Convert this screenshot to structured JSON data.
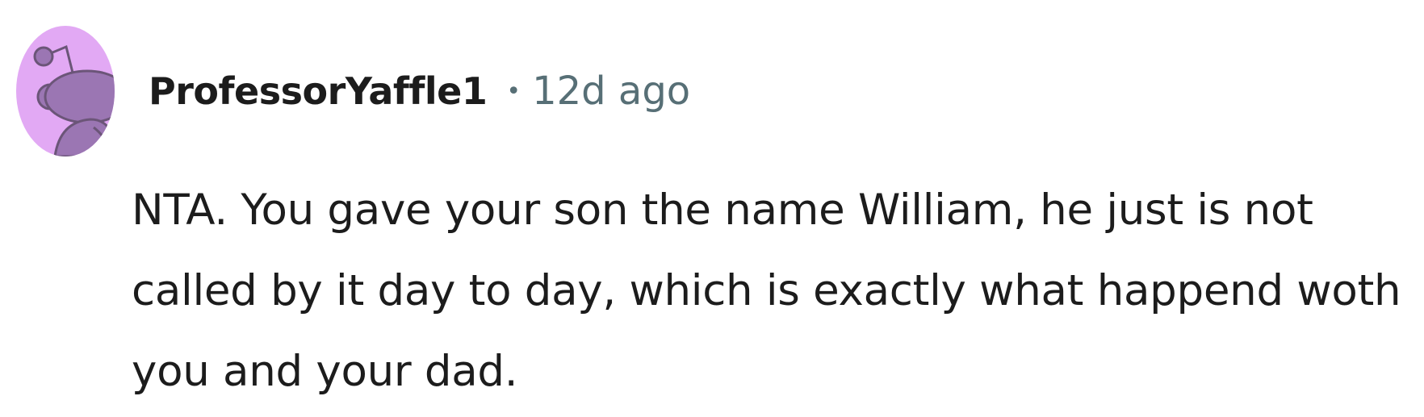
{
  "comment": {
    "author": "ProfessorYaffle1",
    "separator": "•",
    "timestamp": "12d ago",
    "text": "NTA. You gave your son the name William, he just is not called by it day to day, which is exactly what happend woth you and your dad."
  },
  "avatar": {
    "icon": "reddit-snoo-avatar-icon",
    "background_color": "#e2a9f4",
    "figure_color": "#9b76b3"
  }
}
